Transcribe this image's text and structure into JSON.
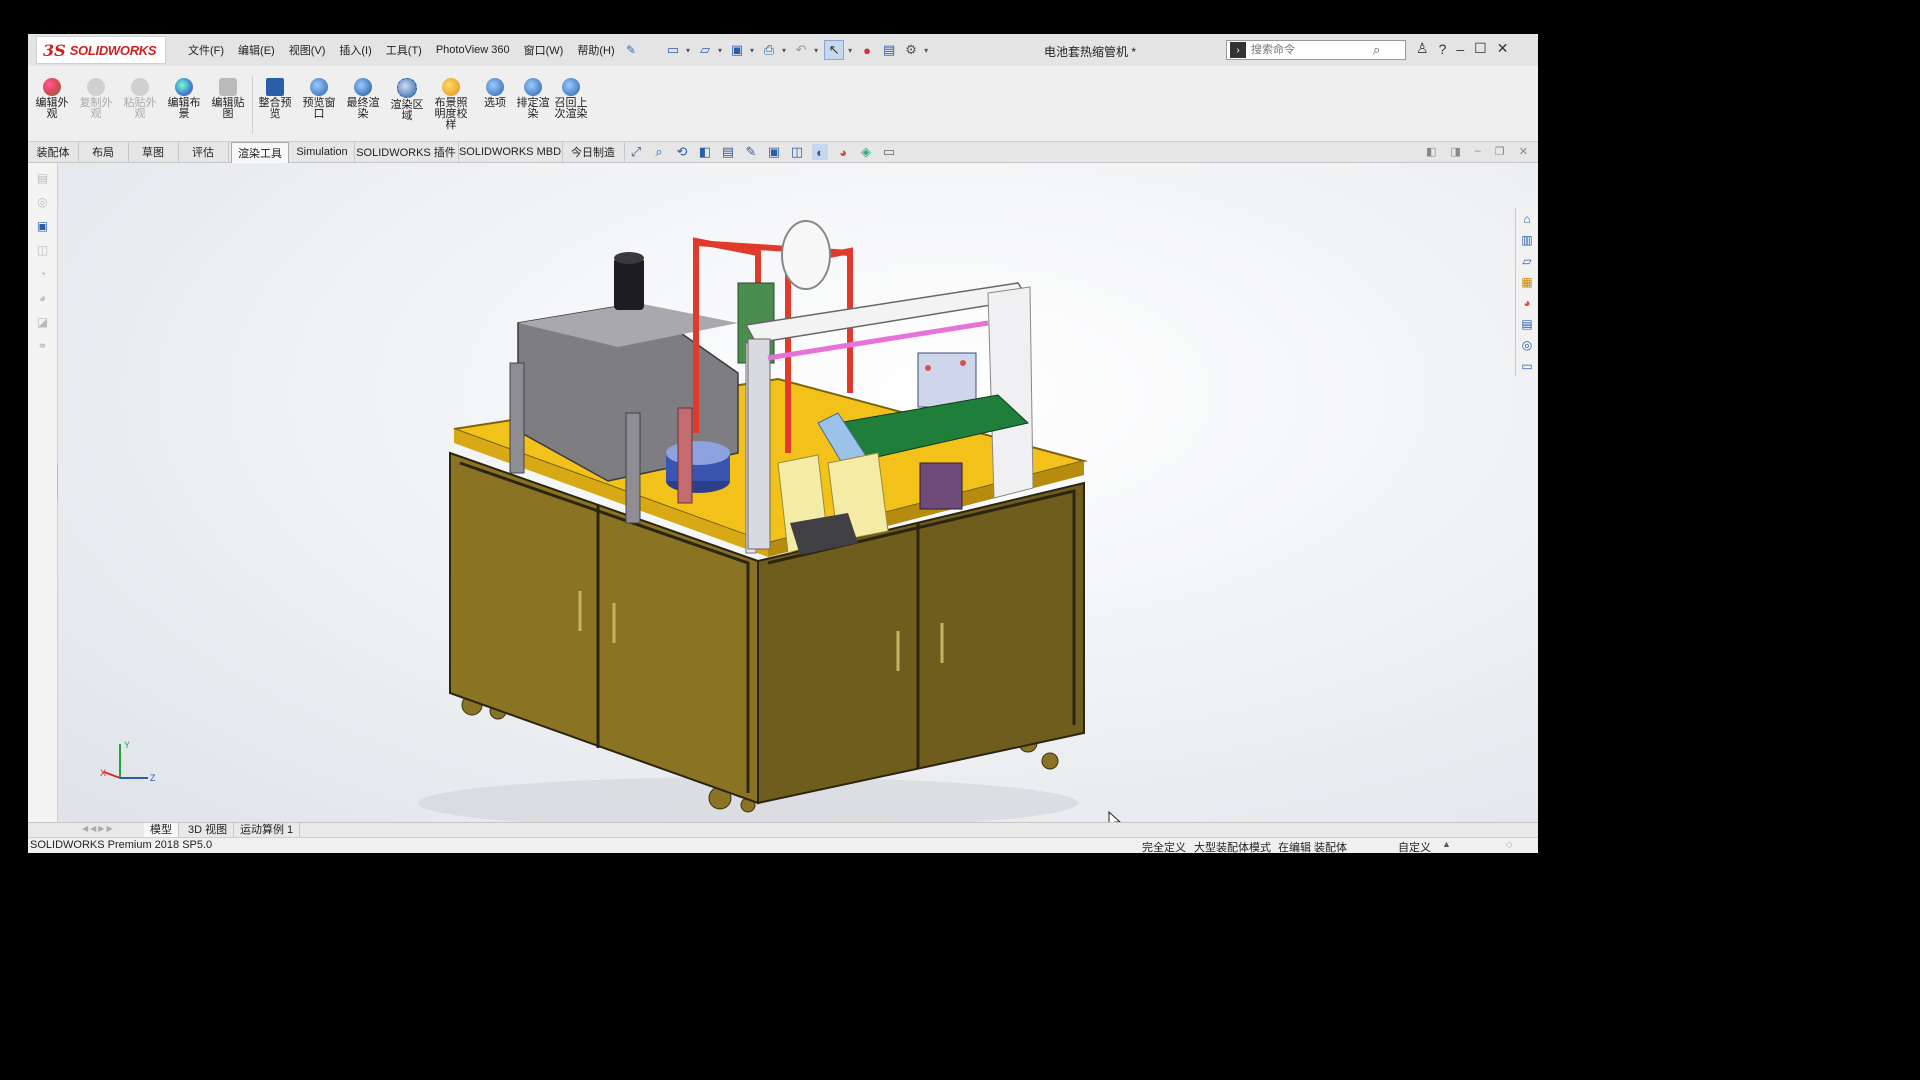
{
  "app": {
    "logo_mark": "3S",
    "logo_text": "SOLIDWORKS",
    "document_title": "电池套热缩管机 *"
  },
  "menu": [
    "文件(F)",
    "编辑(E)",
    "视图(V)",
    "插入(I)",
    "工具(T)",
    "PhotoView 360",
    "窗口(W)",
    "帮助(H)"
  ],
  "search": {
    "placeholder": "搜索命令"
  },
  "ribbon": {
    "buttons": [
      {
        "label": "编辑外观",
        "enabled": true,
        "color": "#d64b3b"
      },
      {
        "label": "复制外观",
        "enabled": false,
        "color": "#888888"
      },
      {
        "label": "粘贴外观",
        "enabled": false,
        "color": "#888888"
      },
      {
        "label": "编辑布景",
        "enabled": true,
        "color": "#3b7fd6"
      },
      {
        "label": "编辑贴图",
        "enabled": true,
        "color": "#9a9a9a"
      },
      {
        "label": "整合预览",
        "enabled": true,
        "color": "#2a5ea8"
      },
      {
        "label": "预览窗口",
        "enabled": true,
        "color": "#2a5ea8"
      },
      {
        "label": "最终渲染",
        "enabled": true,
        "color": "#2a5ea8"
      },
      {
        "label": "渲染区域",
        "enabled": true,
        "color": "#2a5ea8"
      },
      {
        "label": "布景照明度校样",
        "enabled": true,
        "color": "#e08a1e"
      },
      {
        "label": "选项",
        "enabled": true,
        "color": "#2a5ea8"
      },
      {
        "label": "排定渲染",
        "enabled": true,
        "color": "#2a5ea8"
      },
      {
        "label": "召回上次渲染",
        "enabled": true,
        "color": "#2a5ea8"
      }
    ]
  },
  "command_tabs": [
    "装配体",
    "布局",
    "草图",
    "评估",
    "渲染工具",
    "Simulation",
    "SOLIDWORKS 插件",
    "SOLIDWORKS MBD",
    "今日制造"
  ],
  "active_command_tab": "渲染工具",
  "model_tabs": [
    "模型",
    "3D 视图",
    "运动算例 1"
  ],
  "status_bar": {
    "left": "SOLIDWORKS Premium 2018 SP5.0",
    "fully_defined": "完全定义",
    "large_assembly": "大型装配体模式",
    "editing": "在编辑 装配体",
    "custom": "自定义"
  },
  "triad": {
    "x": "X",
    "y": "Y",
    "z": "Z"
  },
  "colors": {
    "cabinet": "#8a7424",
    "tabletop": "#f2c21b",
    "frame": "#7d7d82",
    "red_frame": "#e23a2a",
    "conveyor": "#1f7f3a",
    "accent": "#2a5ea8"
  }
}
